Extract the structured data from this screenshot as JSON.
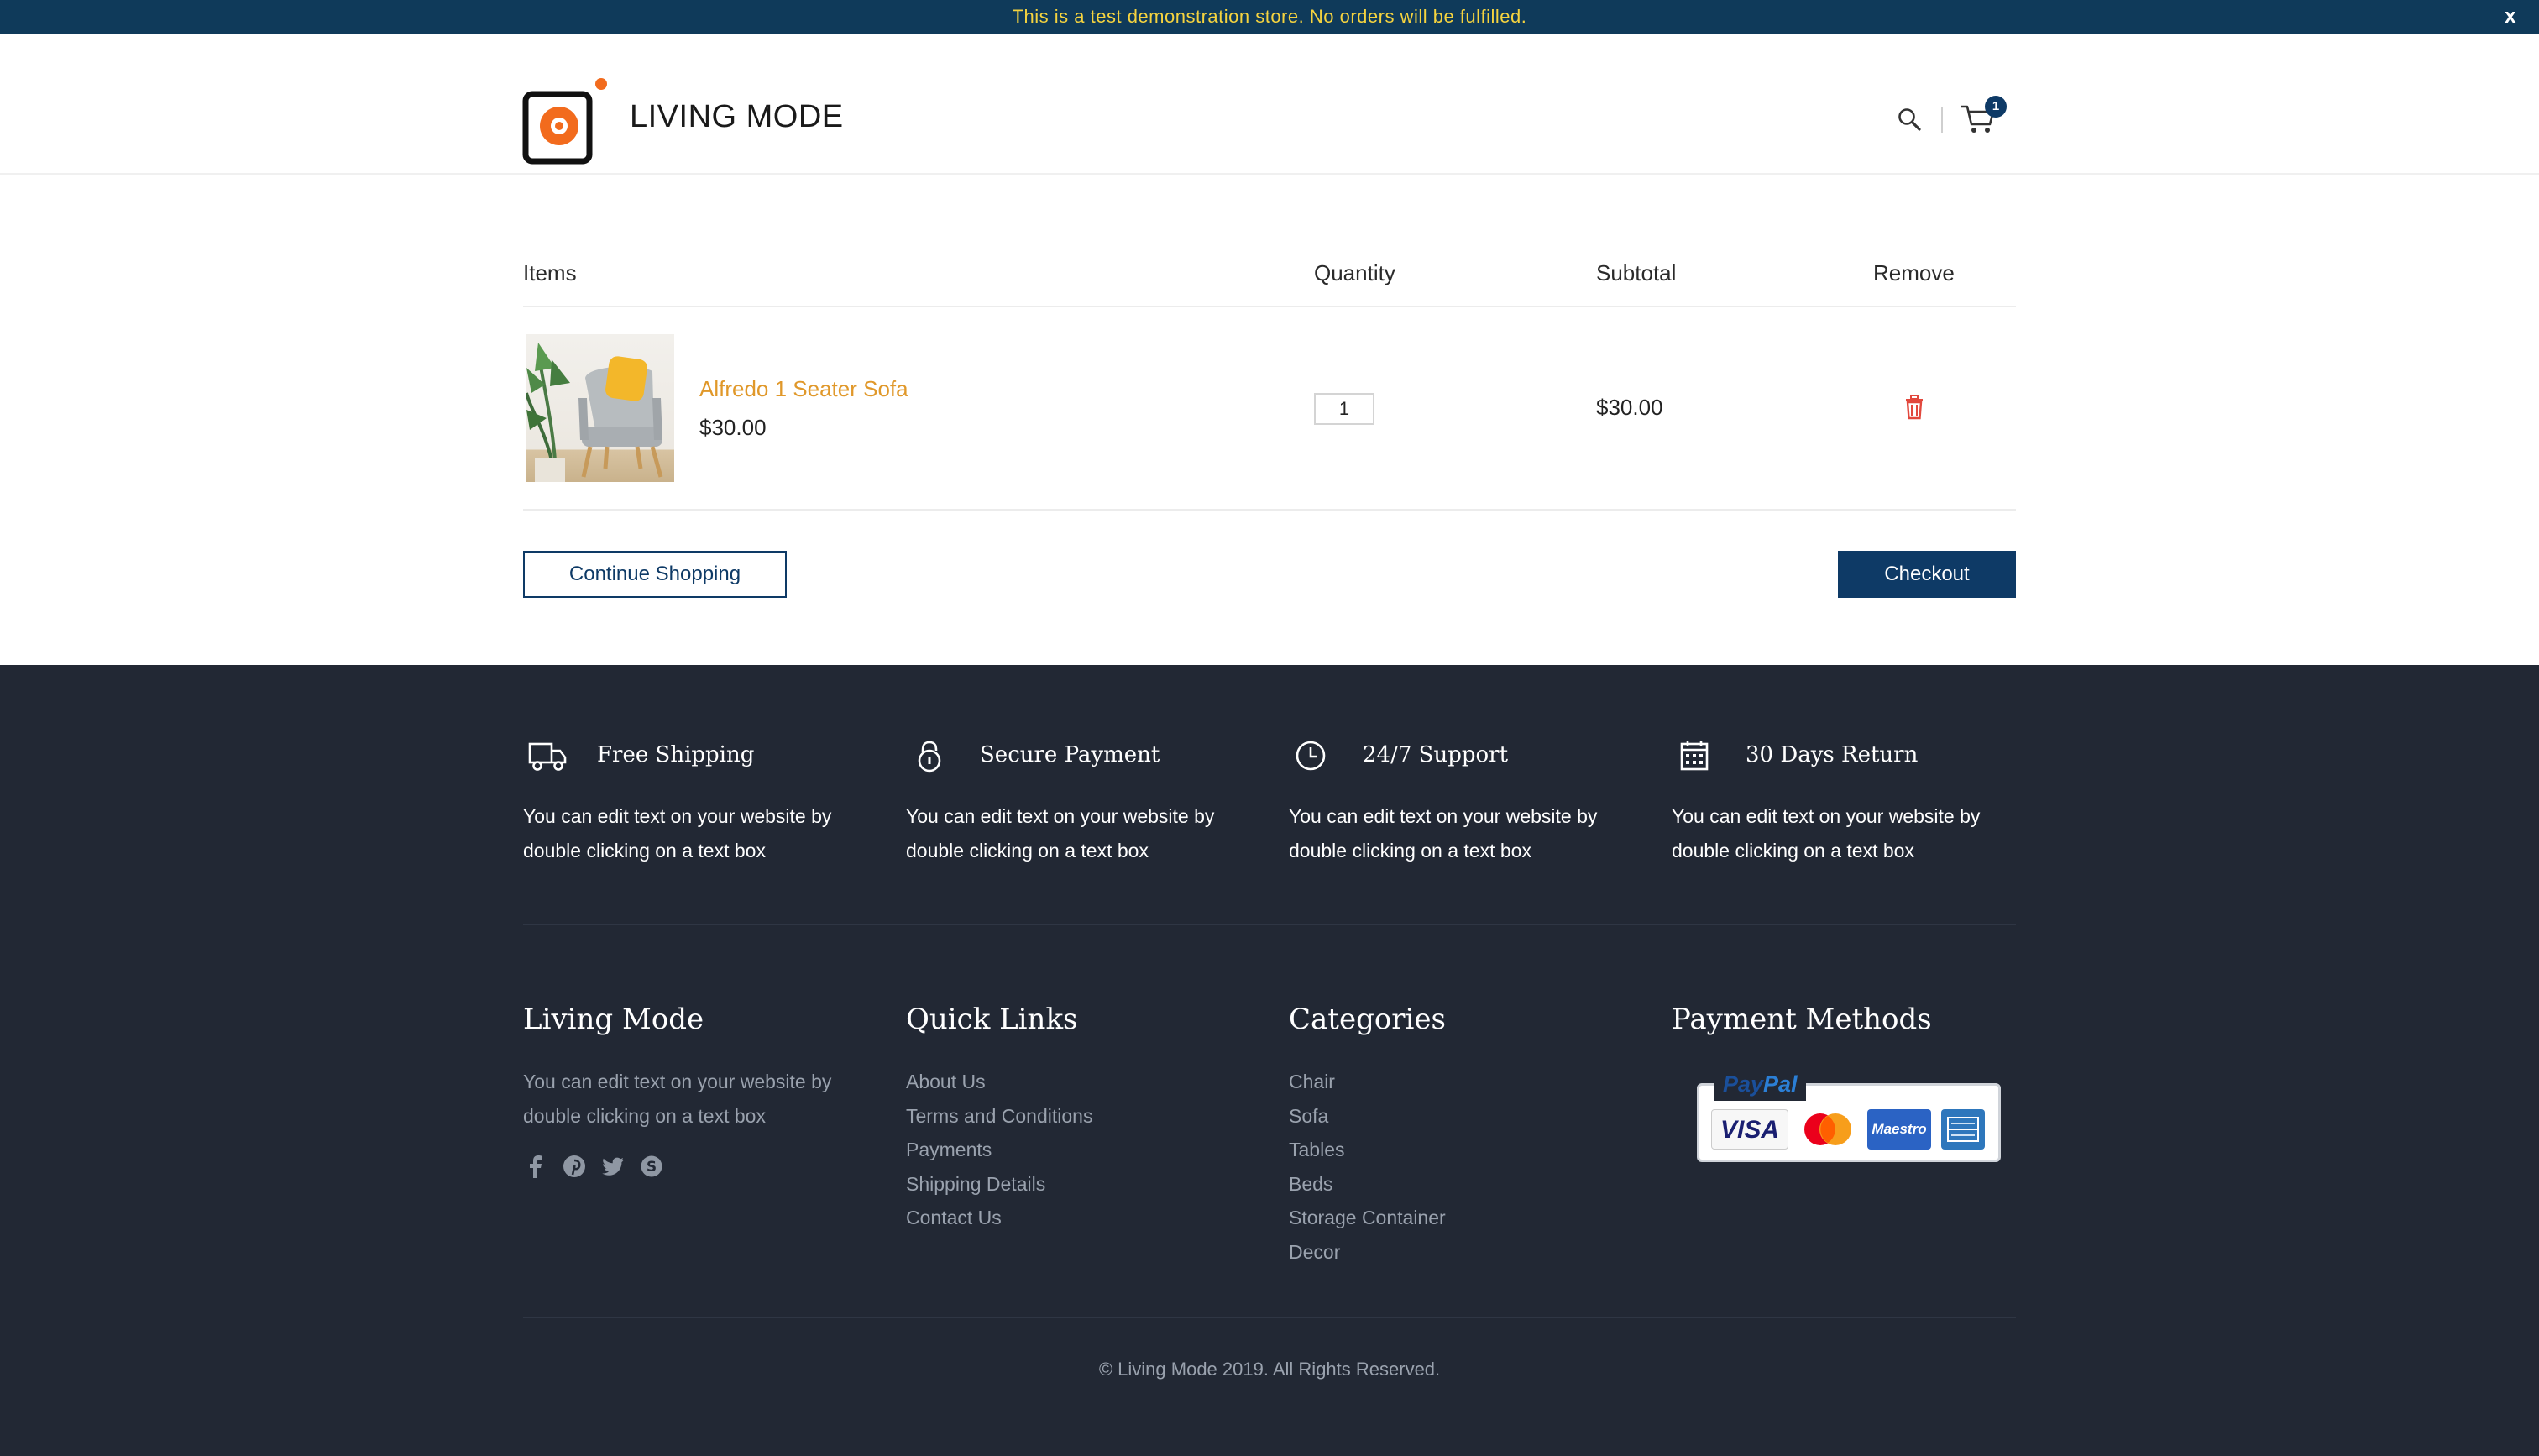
{
  "notice": {
    "text": "This is a test demonstration store. No orders will be fulfilled.",
    "close_label": "x"
  },
  "header": {
    "brand": "LIVING MODE",
    "logo_icon": "living-mode-logo",
    "search_icon": "search-icon",
    "cart_icon": "cart-icon",
    "cart_count": "1",
    "colors": {
      "accent": "#f26b1d",
      "brand_dark": "#0e3a66"
    }
  },
  "cart": {
    "columns": {
      "items": "Items",
      "quantity": "Quantity",
      "subtotal": "Subtotal",
      "remove": "Remove"
    },
    "rows": [
      {
        "name": "Alfredo 1 Seater Sofa",
        "price": "$30.00",
        "quantity": "1",
        "subtotal": "$30.00",
        "remove_icon": "trash-icon"
      }
    ],
    "continue_label": "Continue Shopping",
    "checkout_label": "Checkout"
  },
  "footer": {
    "features": [
      {
        "icon": "truck-icon",
        "title": "Free Shipping",
        "text": "You can edit text on your website by double clicking on a text box"
      },
      {
        "icon": "lock-icon",
        "title": "Secure Payment",
        "text": "You can edit text on your website by double clicking on a text box"
      },
      {
        "icon": "clock-icon",
        "title": "24/7 Support",
        "text": "You can edit text on your website by double clicking on a text box"
      },
      {
        "icon": "calendar-icon",
        "title": "30 Days Return",
        "text": "You can edit text on your website by double clicking on a text box"
      }
    ],
    "about": {
      "title": "Living Mode",
      "text": "You can edit text on your website by double clicking on a text box",
      "social": [
        "facebook-icon",
        "pinterest-icon",
        "twitter-icon",
        "skype-icon"
      ]
    },
    "quick_links": {
      "title": "Quick Links",
      "items": [
        "About Us",
        "Terms and Conditions",
        "Payments",
        "Shipping Details",
        "Contact Us"
      ]
    },
    "categories": {
      "title": "Categories",
      "items": [
        "Chair",
        "Sofa",
        "Tables",
        "Beds",
        "Storage Container",
        "Decor"
      ]
    },
    "payment_methods": {
      "title": "Payment Methods",
      "paypal_part1": "Pay",
      "paypal_part2": "Pal",
      "cards": [
        "VISA",
        "MasterCard",
        "Maestro",
        "American Express"
      ]
    },
    "copyright": "© Living Mode 2019. All Rights Reserved."
  }
}
